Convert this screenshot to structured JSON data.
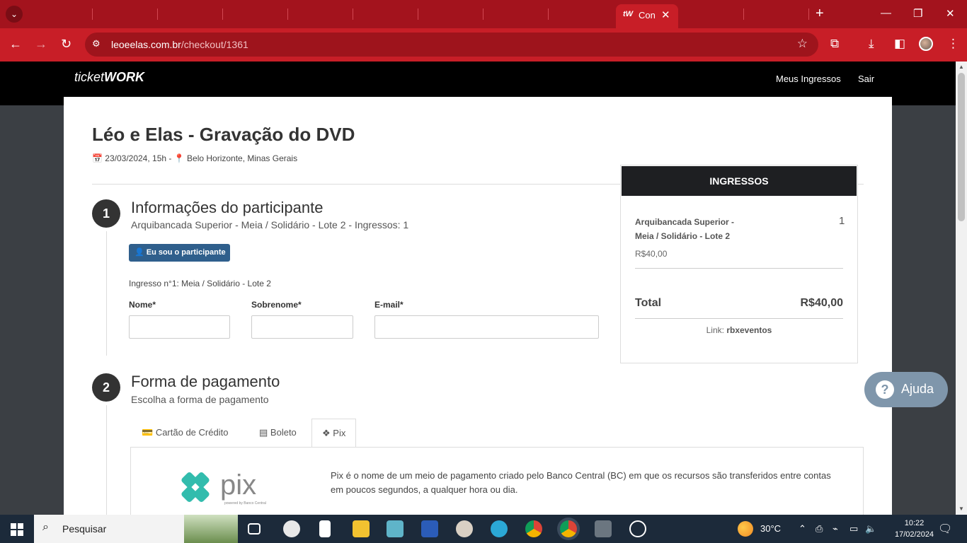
{
  "browser": {
    "tab_title": "Con",
    "tab_favicon": "tW",
    "url_domain": "leoeelas.com.br",
    "url_path": "/checkout/1361"
  },
  "site": {
    "logo_ticket": "ticket",
    "logo_work": "WORK",
    "nav": [
      "Meus Ingressos",
      "Sair"
    ]
  },
  "event": {
    "title": "Léo e Elas - Gravação do DVD",
    "date": "23/03/2024, 15h -",
    "location": "Belo Horizonte, Minas Gerais"
  },
  "step1": {
    "number": "1",
    "title": "Informações do participante",
    "subtitle": "Arquibancada Superior - Meia / Solidário - Lote 2 - Ingressos: 1",
    "button": "Eu sou o participante",
    "ticket_label": "Ingresso n°1: Meia / Solidário - Lote 2",
    "fields": {
      "nome": "Nome*",
      "sobrenome": "Sobrenome*",
      "email": "E-mail*"
    }
  },
  "step2": {
    "number": "2",
    "title": "Forma de pagamento",
    "subtitle": "Escolha a forma de pagamento",
    "tabs": [
      "Cartão de Crédito",
      "Boleto",
      "Pix"
    ],
    "active_tab": "Pix",
    "pix_text": "pix",
    "pix_powered": "powered by Banco Central",
    "pix_description": "Pix é o nome de um meio de pagamento criado pelo Banco Central (BC) em que os recursos são transferidos entre contas em poucos segundos, a qualquer hora ou dia."
  },
  "tickets": {
    "header": "INGRESSOS",
    "item_name": "Arquibancada Superior - Meia / Solidário - Lote 2",
    "item_qty": "1",
    "item_price": "R$40,00",
    "total_label": "Total",
    "total_value": "R$40,00",
    "link_label": "Link:",
    "link_value": "rbxeventos"
  },
  "help": {
    "label": "Ajuda"
  },
  "taskbar": {
    "search_placeholder": "Pesquisar",
    "temperature": "30°C",
    "time": "10:22",
    "date": "17/02/2024"
  },
  "colors": {
    "browser_red": "#c81e27",
    "tab_strip": "#a3131d",
    "header_black": "#000000",
    "button_blue": "#2f5f8c",
    "pix_teal": "#32bcad"
  }
}
